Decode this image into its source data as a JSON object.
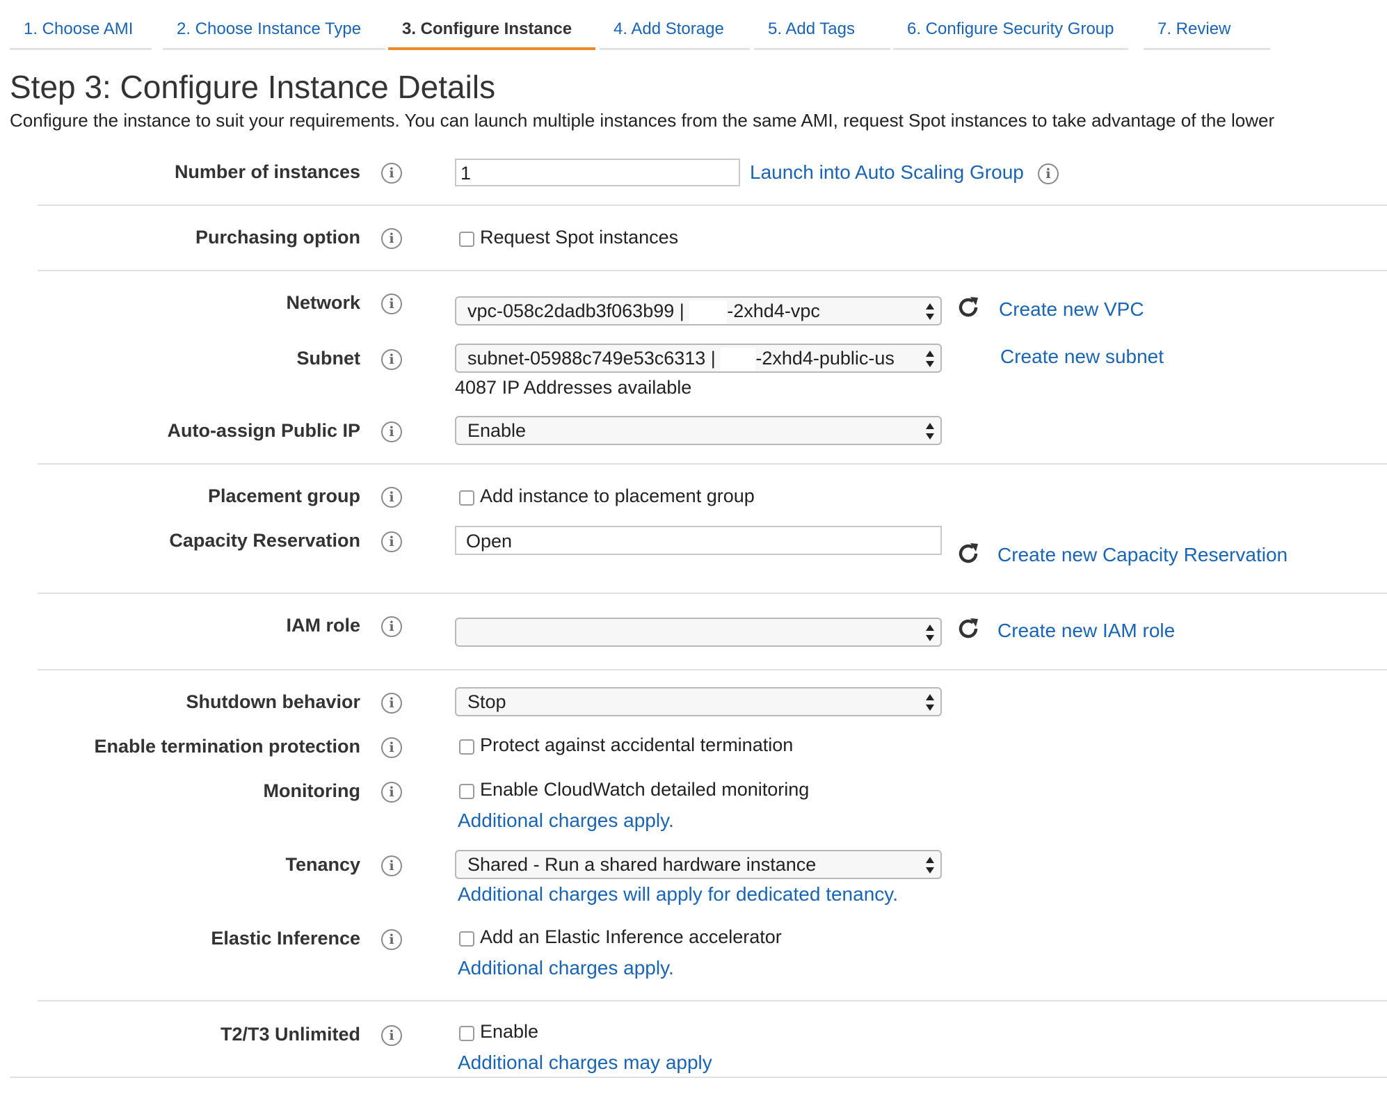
{
  "wizard": {
    "tabs": [
      {
        "label": "1. Choose AMI"
      },
      {
        "label": "2. Choose Instance Type"
      },
      {
        "label": "3. Configure Instance"
      },
      {
        "label": "4. Add Storage"
      },
      {
        "label": "5. Add Tags"
      },
      {
        "label": "6. Configure Security Group"
      },
      {
        "label": "7. Review"
      }
    ],
    "active_tab": "3. Configure Instance"
  },
  "page": {
    "title": "Step 3: Configure Instance Details",
    "description": "Configure the instance to suit your requirements. You can launch multiple instances from the same AMI, request Spot instances to take advantage of the lower"
  },
  "form": {
    "number_of_instances": {
      "label": "Number of instances",
      "value": "1",
      "link": "Launch into Auto Scaling Group"
    },
    "purchasing_option": {
      "label": "Purchasing option",
      "checkbox_label": "Request Spot instances",
      "checked": false
    },
    "network": {
      "label": "Network",
      "value_prefix": "vpc-058c2dadb3f063b99 | ",
      "value_suffix": "-2xhd4-vpc",
      "link": "Create new VPC"
    },
    "subnet": {
      "label": "Subnet",
      "value_prefix": "subnet-05988c749e53c6313 | ",
      "value_suffix": "-2xhd4-public-us",
      "link": "Create new subnet",
      "helper": "4087 IP Addresses available"
    },
    "auto_assign_public_ip": {
      "label": "Auto-assign Public IP",
      "value": "Enable"
    },
    "placement_group": {
      "label": "Placement group",
      "checkbox_label": "Add instance to placement group",
      "checked": false
    },
    "capacity_reservation": {
      "label": "Capacity Reservation",
      "value": "Open",
      "link": "Create new Capacity Reservation"
    },
    "iam_role": {
      "label": "IAM role",
      "value": "",
      "link": "Create new IAM role"
    },
    "shutdown_behavior": {
      "label": "Shutdown behavior",
      "value": "Stop"
    },
    "termination_protection": {
      "label": "Enable termination protection",
      "checkbox_label": "Protect against accidental termination",
      "checked": false
    },
    "monitoring": {
      "label": "Monitoring",
      "checkbox_label": "Enable CloudWatch detailed monitoring",
      "checked": false,
      "link": "Additional charges apply."
    },
    "tenancy": {
      "label": "Tenancy",
      "value": "Shared - Run a shared hardware instance",
      "link": "Additional charges will apply for dedicated tenancy."
    },
    "elastic_inference": {
      "label": "Elastic Inference",
      "checkbox_label": "Add an Elastic Inference accelerator",
      "checked": false,
      "link": "Additional charges apply."
    },
    "t2t3_unlimited": {
      "label": "T2/T3 Unlimited",
      "checkbox_label": "Enable",
      "checked": false,
      "link": "Additional charges may apply"
    }
  },
  "colors": {
    "link": "#1a64b4",
    "active_tab_underline": "#ec8a26",
    "divider": "#e0e0e0"
  },
  "icons": {
    "info": "info-icon",
    "refresh": "refresh-icon",
    "select_arrows": "updown-arrows-icon"
  }
}
